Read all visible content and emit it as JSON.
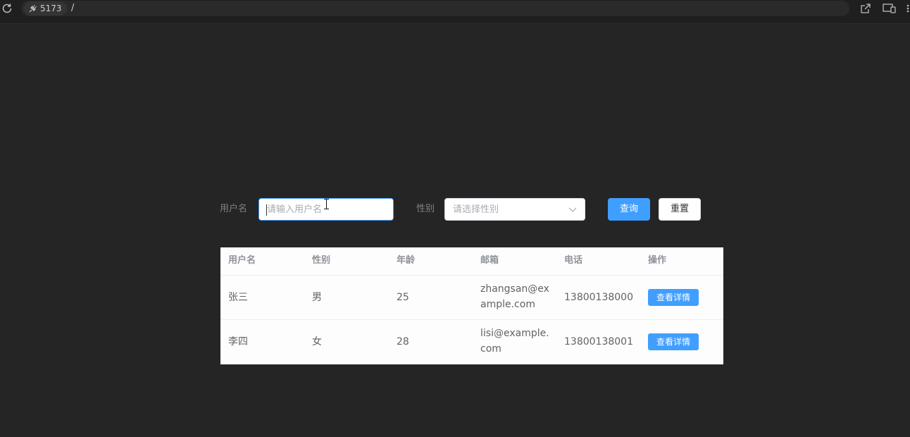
{
  "browser": {
    "port": "5173",
    "path": "/"
  },
  "search_form": {
    "username_label": "用户名",
    "username_placeholder": "请输入用户名",
    "gender_label": "性别",
    "gender_placeholder": "请选择性别",
    "query_button": "查询",
    "reset_button": "重置"
  },
  "table": {
    "columns": [
      "用户名",
      "性别",
      "年龄",
      "邮箱",
      "电话",
      "操作"
    ],
    "rows": [
      {
        "username": "张三",
        "gender": "男",
        "age": "25",
        "email": "zhangsan@example.com",
        "phone": "13800138000",
        "action": "查看详情"
      },
      {
        "username": "李四",
        "gender": "女",
        "age": "28",
        "email": "lisi@example.com",
        "phone": "13800138001",
        "action": "查看详情"
      }
    ]
  },
  "colors": {
    "primary": "#409eff",
    "page_background": "#252525"
  }
}
